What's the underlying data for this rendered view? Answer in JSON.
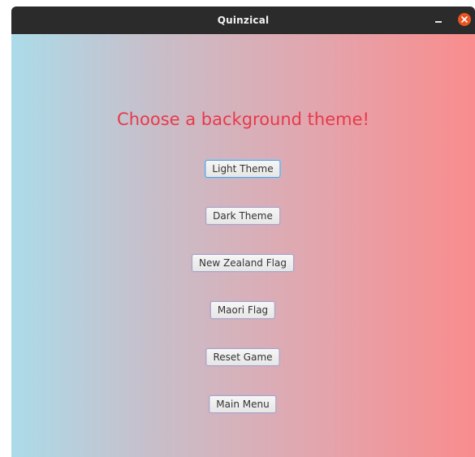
{
  "window": {
    "title": "Quinzical",
    "controls": {
      "minimize_icon": "minimize-icon",
      "close_icon": "close-icon",
      "close_color": "#e95420"
    }
  },
  "theme_menu": {
    "heading": "Choose a background theme!",
    "heading_color": "#e8394a",
    "buttons": [
      {
        "label": "Light Theme",
        "focused": true
      },
      {
        "label": "Dark Theme",
        "focused": false
      },
      {
        "label": "New Zealand Flag",
        "focused": false
      },
      {
        "label": "Maori Flag",
        "focused": false
      },
      {
        "label": "Reset Game",
        "focused": false
      },
      {
        "label": "Main Menu",
        "focused": false
      }
    ]
  },
  "background_gradient": [
    "#acdbe9",
    "#c7bfca",
    "#e2a6ae",
    "#f98c8d"
  ]
}
